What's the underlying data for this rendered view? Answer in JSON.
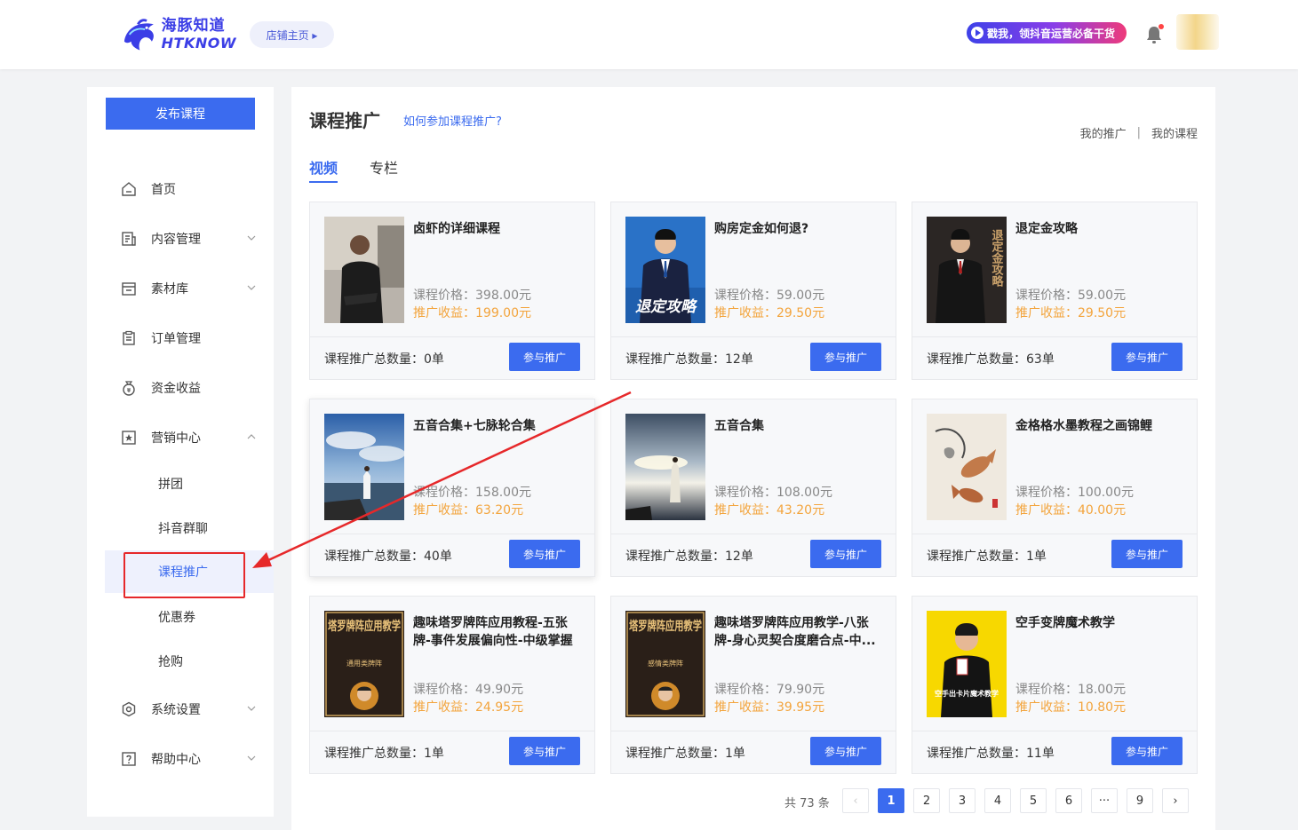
{
  "header": {
    "logo_cn": "海豚知道",
    "logo_en": "HTKNOW",
    "store_button": "店铺主页 ▸",
    "banner_text": "戳我，领抖音运营必备干货"
  },
  "sidebar": {
    "publish_button": "发布课程",
    "items": [
      {
        "label": "首页",
        "icon": "home-icon"
      },
      {
        "label": "内容管理",
        "icon": "content-icon"
      },
      {
        "label": "素材库",
        "icon": "folder-icon"
      },
      {
        "label": "订单管理",
        "icon": "clipboard-icon"
      },
      {
        "label": "资金收益",
        "icon": "money-bag-icon"
      },
      {
        "label": "营销中心",
        "icon": "star-badge-icon"
      },
      {
        "label": "系统设置",
        "icon": "settings-icon"
      },
      {
        "label": "帮助中心",
        "icon": "help-icon"
      }
    ],
    "sub_items": [
      {
        "label": "拼团"
      },
      {
        "label": "抖音群聊"
      },
      {
        "label": "课程推广"
      },
      {
        "label": "优惠券"
      },
      {
        "label": "抢购"
      }
    ]
  },
  "main": {
    "title": "课程推广",
    "help_link": "如何参加课程推广?",
    "my_promotion": "我的推广",
    "separator": "|",
    "my_courses": "我的课程",
    "tabs": [
      {
        "label": "视频"
      },
      {
        "label": "专栏"
      }
    ],
    "cards": [
      {
        "title": "卤虾的详细课程",
        "price": "课程价格：398.00元",
        "income": "推广收益：199.00元",
        "count": "课程推广总数量：0单",
        "button": "参与推广"
      },
      {
        "title": "购房定金如何退?",
        "price": "课程价格：59.00元",
        "income": "推广收益：29.50元",
        "count": "课程推广总数量：12单",
        "button": "参与推广",
        "thumb_text": "退定攻略"
      },
      {
        "title": "退定金攻略",
        "price": "课程价格：59.00元",
        "income": "推广收益：29.50元",
        "count": "课程推广总数量：63单",
        "button": "参与推广",
        "thumb_text": "退定金攻略"
      },
      {
        "title": "五音合集+七脉轮合集",
        "price": "课程价格：158.00元",
        "income": "推广收益：63.20元",
        "count": "课程推广总数量：40单",
        "button": "参与推广"
      },
      {
        "title": "五音合集",
        "price": "课程价格：108.00元",
        "income": "推广收益：43.20元",
        "count": "课程推广总数量：12单",
        "button": "参与推广"
      },
      {
        "title": "金格格水墨教程之画锦鲤",
        "price": "课程价格：100.00元",
        "income": "推广收益：40.00元",
        "count": "课程推广总数量：1单",
        "button": "参与推广"
      },
      {
        "title": "趣味塔罗牌阵应用教程-五张牌-事件发展偏向性-中级掌握",
        "price": "课程价格：49.90元",
        "income": "推广收益：24.95元",
        "count": "课程推广总数量：1单",
        "button": "参与推广",
        "thumb_text": "塔罗牌阵应用教学",
        "thumb_sub": "通用类牌阵"
      },
      {
        "title": "趣味塔罗牌阵应用教学-八张牌-身心灵契合度磨合点-中...",
        "price": "课程价格：79.90元",
        "income": "推广收益：39.95元",
        "count": "课程推广总数量：1单",
        "button": "参与推广",
        "thumb_text": "塔罗牌阵应用教学",
        "thumb_sub": "感情类牌阵"
      },
      {
        "title": "空手变牌魔术教学",
        "price": "课程价格：18.00元",
        "income": "推广收益：10.80元",
        "count": "课程推广总数量：11单",
        "button": "参与推广",
        "thumb_text": "空手出卡片魔术教学"
      }
    ],
    "pagination": {
      "total": "共 73 条",
      "prev": "‹",
      "pages": [
        "1",
        "2",
        "3",
        "4",
        "5",
        "6",
        "···",
        "9"
      ],
      "next": "›",
      "current": "1"
    }
  },
  "colors": {
    "primary": "#3b6bef",
    "income": "#f3a43c",
    "annotation": "#e6282a"
  }
}
